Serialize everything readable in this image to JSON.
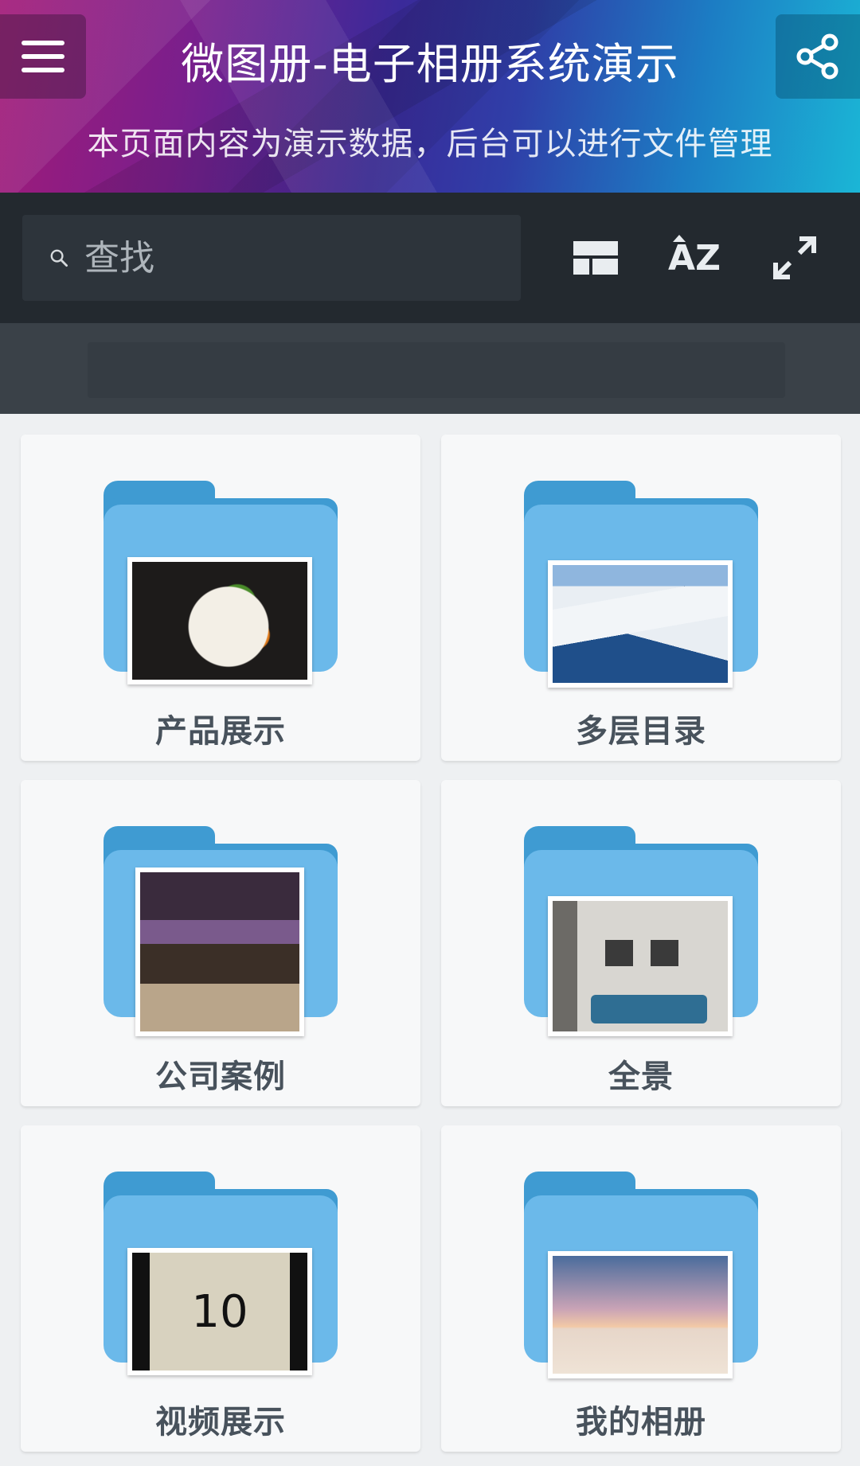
{
  "header": {
    "title": "微图册-电子相册系统演示",
    "subtitle": "本页面内容为演示数据，后台可以进行文件管理",
    "menu_icon": "hamburger-menu-icon",
    "share_icon": "share-icon"
  },
  "toolbar": {
    "search_placeholder": "查找",
    "search_icon": "search-icon",
    "layout_icon": "layout-toggle-icon",
    "sort_label": "AZ",
    "sort_icon": "sort-az-icon",
    "expand_icon": "fullscreen-icon"
  },
  "folders": [
    {
      "label": "产品展示",
      "thumbnail": "food-photo"
    },
    {
      "label": "多层目录",
      "thumbnail": "snow-mountain-photo"
    },
    {
      "label": "公司案例",
      "thumbnail": "restaurant-interior-photo"
    },
    {
      "label": "全景",
      "thumbnail": "living-room-photo"
    },
    {
      "label": "视频展示",
      "thumbnail": "film-countdown-photo",
      "thumbnail_text": "10"
    },
    {
      "label": "我的相册",
      "thumbnail": "beach-sunset-photo"
    }
  ],
  "colors": {
    "toolbar_bg": "#23292f",
    "folder_front": "#6bb9ea",
    "folder_back": "#3f9bd2",
    "label_text": "#48525c"
  }
}
